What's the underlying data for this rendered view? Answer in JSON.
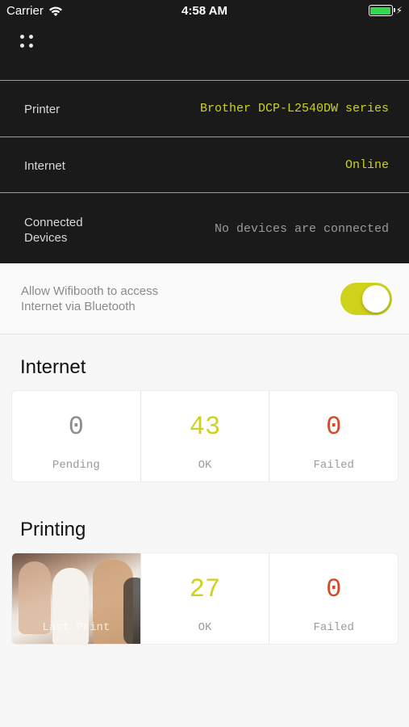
{
  "statusbar": {
    "carrier": "Carrier",
    "time": "4:58 AM",
    "battery_color": "#32d74b"
  },
  "header": {
    "menu_icon": "grid-dots-icon"
  },
  "info_rows": {
    "printer": {
      "label": "Printer",
      "value": "Brother DCP-L2540DW series"
    },
    "internet": {
      "label": "Internet",
      "value": "Online"
    },
    "devices": {
      "label_line1": "Connected",
      "label_line2": "Devices",
      "value": "No devices are connected"
    }
  },
  "bluetooth_toggle": {
    "line1": "Allow Wifibooth to access",
    "line2": "Internet via Bluetooth",
    "state": "on"
  },
  "internet_section": {
    "title": "Internet",
    "stats": [
      {
        "value": "0",
        "caption": "Pending"
      },
      {
        "value": "43",
        "caption": "OK"
      },
      {
        "value": "0",
        "caption": "Failed"
      }
    ]
  },
  "printing_section": {
    "title": "Printing",
    "last_print_caption": "Last Print",
    "stats": [
      {
        "value": "27",
        "caption": "OK"
      },
      {
        "value": "0",
        "caption": "Failed"
      }
    ]
  },
  "colors": {
    "accent": "#cfd21a",
    "failed": "#d34a2a",
    "dark_bg": "#1a1a1a"
  }
}
